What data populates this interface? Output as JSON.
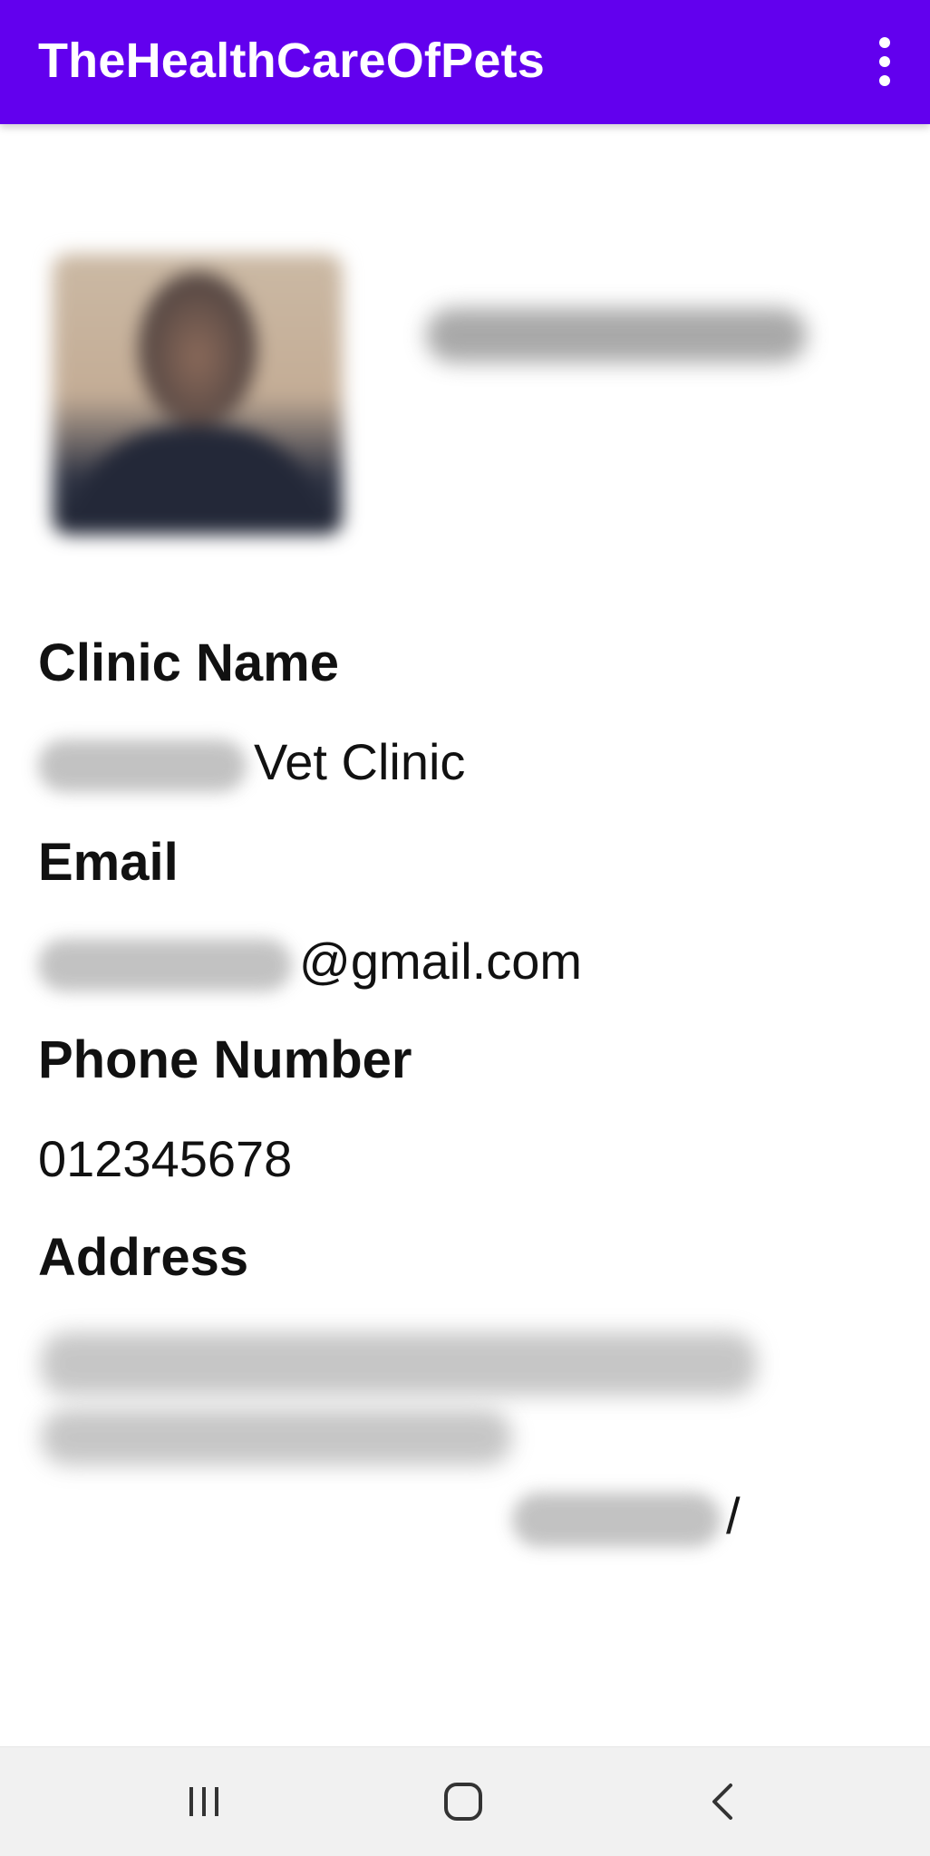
{
  "app_bar": {
    "title": "TheHealthCareOfPets",
    "background_color": "#6200ee",
    "overflow_icon": "more-vert-icon"
  },
  "profile": {
    "avatar_icon": "profile-photo",
    "fields": {
      "clinic_name": {
        "label": "Clinic Name",
        "value": "Vet Clinic"
      },
      "email": {
        "label": "Email",
        "value": "@gmail.com"
      },
      "phone": {
        "label": "Phone Number",
        "value": "012345678"
      },
      "address": {
        "label": "Address",
        "value_suffix": "/"
      }
    }
  },
  "system_nav": {
    "recent_icon": "recent-apps-icon",
    "home_icon": "home-icon",
    "back_icon": "back-icon"
  }
}
